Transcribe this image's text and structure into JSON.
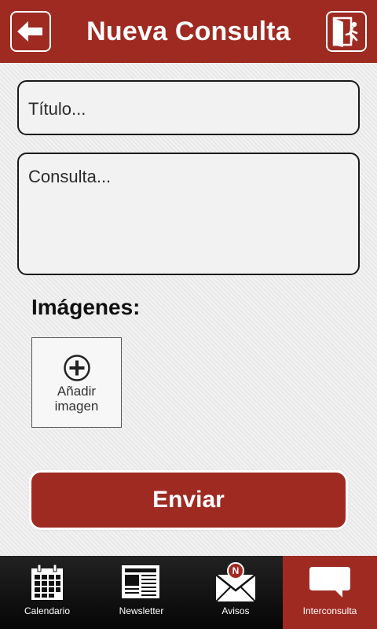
{
  "header": {
    "title": "Nueva Consulta",
    "back_icon": "arrow-left-icon",
    "exit_icon": "exit-door-icon"
  },
  "form": {
    "title_placeholder": "Título...",
    "query_placeholder": "Consulta...",
    "images_label": "Imágenes:",
    "add_image_label": "Añadir\nimagen",
    "send_label": "Enviar"
  },
  "nav": {
    "items": [
      {
        "label": "Calendario",
        "icon": "calendar-icon"
      },
      {
        "label": "Newsletter",
        "icon": "newspaper-icon"
      },
      {
        "label": "Avisos",
        "icon": "mail-icon",
        "badge": "N"
      },
      {
        "label": "Interconsulta",
        "icon": "chat-bubble-icon",
        "active": true
      }
    ]
  },
  "colors": {
    "primary": "#9e2a22",
    "background": "#ececec",
    "nav_bg": "#111111"
  }
}
